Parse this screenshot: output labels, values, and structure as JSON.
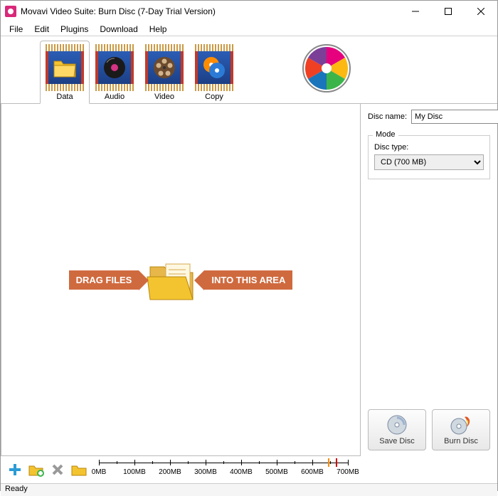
{
  "window": {
    "title": "Movavi Video Suite: Burn Disc (7-Day Trial Version)"
  },
  "menu": {
    "file": "File",
    "edit": "Edit",
    "plugins": "Plugins",
    "download": "Download",
    "help": "Help"
  },
  "tabs": {
    "data": "Data",
    "audio": "Audio",
    "video": "Video",
    "copy": "Copy"
  },
  "dropzone": {
    "left": "DRAG FILES",
    "right": "INTO THIS AREA"
  },
  "sidebar": {
    "disc_name_label": "Disc name:",
    "disc_name_value": "My Disc",
    "mode_title": "Mode",
    "disc_type_label": "Disc type:",
    "disc_type_value": "CD (700 MB)",
    "save_disc": "Save Disc",
    "burn_disc": "Burn Disc"
  },
  "ruler": {
    "ticks": [
      "0MB",
      "100MB",
      "200MB",
      "300MB",
      "400MB",
      "500MB",
      "600MB",
      "700MB"
    ]
  },
  "status": {
    "text": "Ready"
  }
}
